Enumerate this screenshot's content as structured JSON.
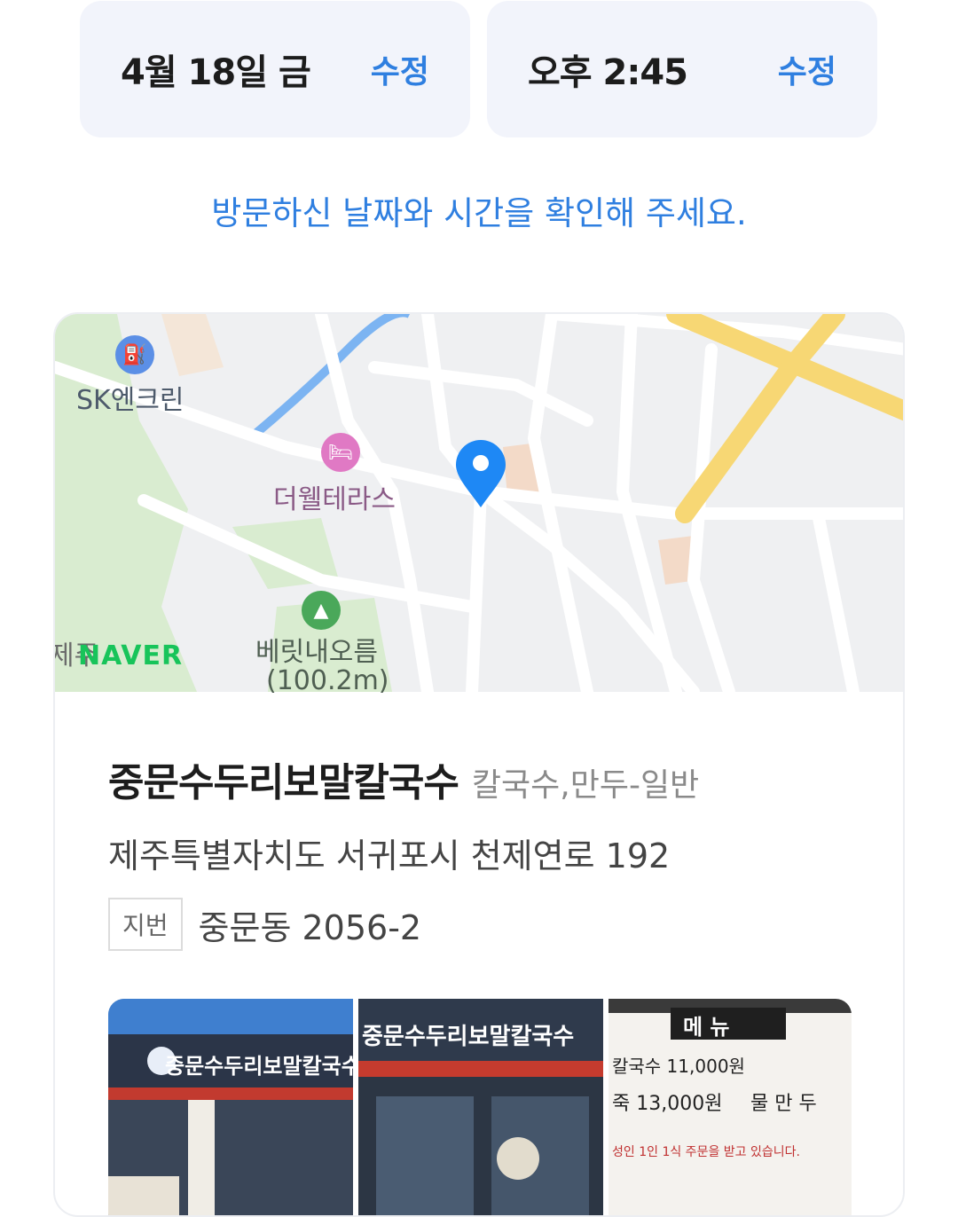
{
  "visit": {
    "date": "4월 18일 금",
    "date_edit": "수정",
    "time": "오후 2:45",
    "time_edit": "수정",
    "notice": "방문하신 날짜와 시간을 확인해 주세요."
  },
  "map": {
    "labels": {
      "gas_station": "SK엔크린",
      "hotel": "더웰테라스",
      "mountain": "베릿내오름",
      "mountain_height": "(100.2m)",
      "partial": "제주",
      "brand": "NAVER"
    },
    "colors": {
      "pin": "#1e88f5",
      "highway": "#f7d774",
      "water": "#7cb4f2",
      "park": "#d9ecd0"
    },
    "icons": [
      "fuel-icon",
      "hotel-icon",
      "mountain-icon",
      "location-pin-icon"
    ]
  },
  "place": {
    "name": "중문수두리보말칼국수",
    "category": "칼국수,만두-일반",
    "road_address": "제주특별자치도 서귀포시 천제연로 192",
    "jibun_label": "지번",
    "jibun_address": "중문동 2056-2"
  },
  "photos": {
    "sign_text": "중문수두리보말칼국수",
    "menu_title": "메  뉴",
    "menu_line1": "칼국수 11,000원",
    "menu_line2": "죽 13,000원",
    "menu_line3": "물 만 두",
    "menu_note": "성인 1인 1식 주문을 받고 있습니다."
  }
}
